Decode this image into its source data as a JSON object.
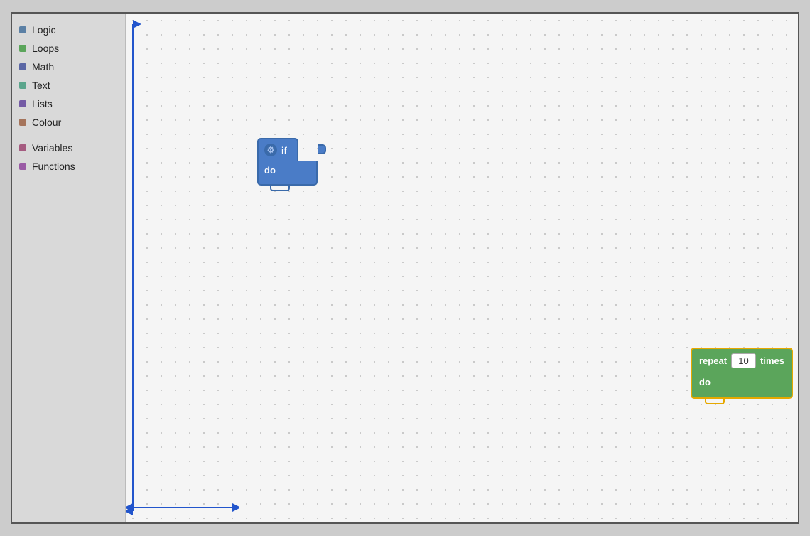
{
  "sidebar": {
    "items": [
      {
        "id": "logic",
        "label": "Logic",
        "color": "#5b80a5"
      },
      {
        "id": "loops",
        "label": "Loops",
        "color": "#5ba55b"
      },
      {
        "id": "math",
        "label": "Math",
        "color": "#5b67a5"
      },
      {
        "id": "text",
        "label": "Text",
        "color": "#5ba58c"
      },
      {
        "id": "lists",
        "label": "Lists",
        "color": "#745ba5"
      },
      {
        "id": "colour",
        "label": "Colour",
        "color": "#a5745b"
      },
      {
        "id": "variables",
        "label": "Variables",
        "color": "#a55b80"
      },
      {
        "id": "functions",
        "label": "Functions",
        "color": "#9a5ba5"
      }
    ]
  },
  "if_block": {
    "if_label": "if",
    "do_label": "do",
    "gear_symbol": "⚙"
  },
  "repeat_block": {
    "repeat_label": "repeat",
    "times_label": "times",
    "do_label": "do",
    "count_value": "10"
  }
}
